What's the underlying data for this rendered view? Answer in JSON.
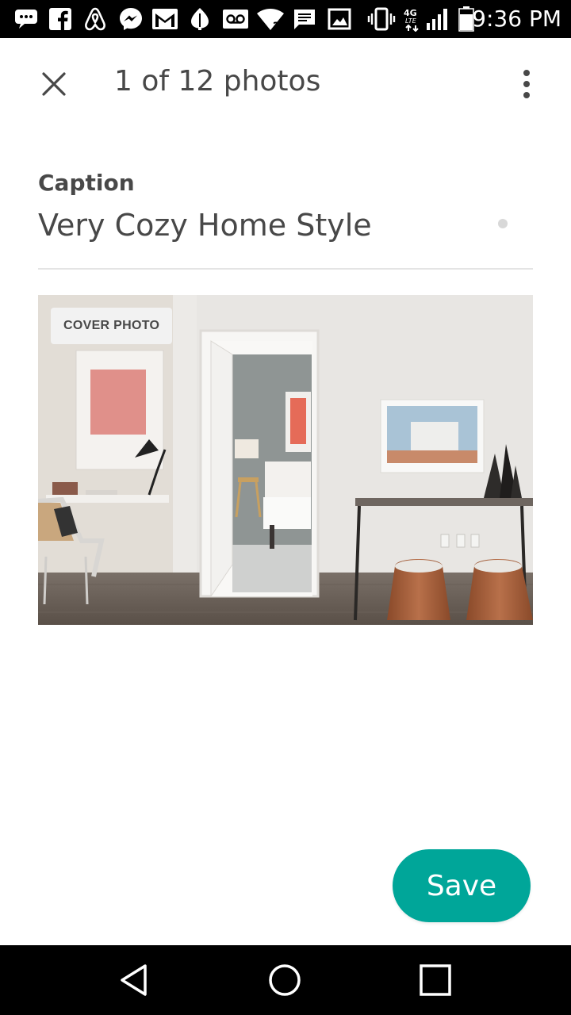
{
  "status_bar": {
    "time": "9:36 PM",
    "network": "4G LTE",
    "icons": [
      "chat-icon",
      "facebook-icon",
      "airbnb-icon",
      "messenger-icon",
      "gmail-icon",
      "leaf-icon",
      "voicemail-icon",
      "wifi-icon",
      "message-icon",
      "gallery-icon",
      "vibrate-icon",
      "network-4g-icon",
      "signal-icon",
      "battery-icon"
    ]
  },
  "header": {
    "title": "1 of 12 photos",
    "close_icon": "close-icon",
    "more_icon": "more-vertical-icon"
  },
  "caption": {
    "label": "Caption",
    "value": "Very Cozy Home Style"
  },
  "photo": {
    "badge": "COVER PHOTO"
  },
  "actions": {
    "save_label": "Save"
  },
  "colors": {
    "accent": "#00a699",
    "text": "#484848",
    "divider": "#e4e4e4"
  },
  "nav_bar": {
    "icons": [
      "back-icon",
      "home-icon",
      "recents-icon"
    ]
  }
}
